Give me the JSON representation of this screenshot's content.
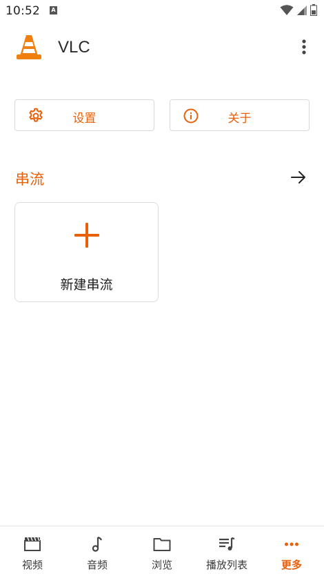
{
  "status_bar": {
    "time": "10:52",
    "notification_letter": "A"
  },
  "app_bar": {
    "title": "VLC",
    "icon": "vlc-cone-logo"
  },
  "actions": {
    "settings_label": "设置",
    "about_label": "关于"
  },
  "streams": {
    "section_title": "串流",
    "new_stream_label": "新建串流"
  },
  "bottom_nav": {
    "items": [
      {
        "label": "视频",
        "icon": "video-icon"
      },
      {
        "label": "音频",
        "icon": "music-note-icon"
      },
      {
        "label": "浏览",
        "icon": "folder-icon"
      },
      {
        "label": "播放列表",
        "icon": "playlist-icon"
      },
      {
        "label": "更多",
        "icon": "more-dots-icon"
      }
    ],
    "active_index": 4
  },
  "colors": {
    "accent": "#e8600a",
    "text": "#202020",
    "border": "#d8d8d8"
  }
}
